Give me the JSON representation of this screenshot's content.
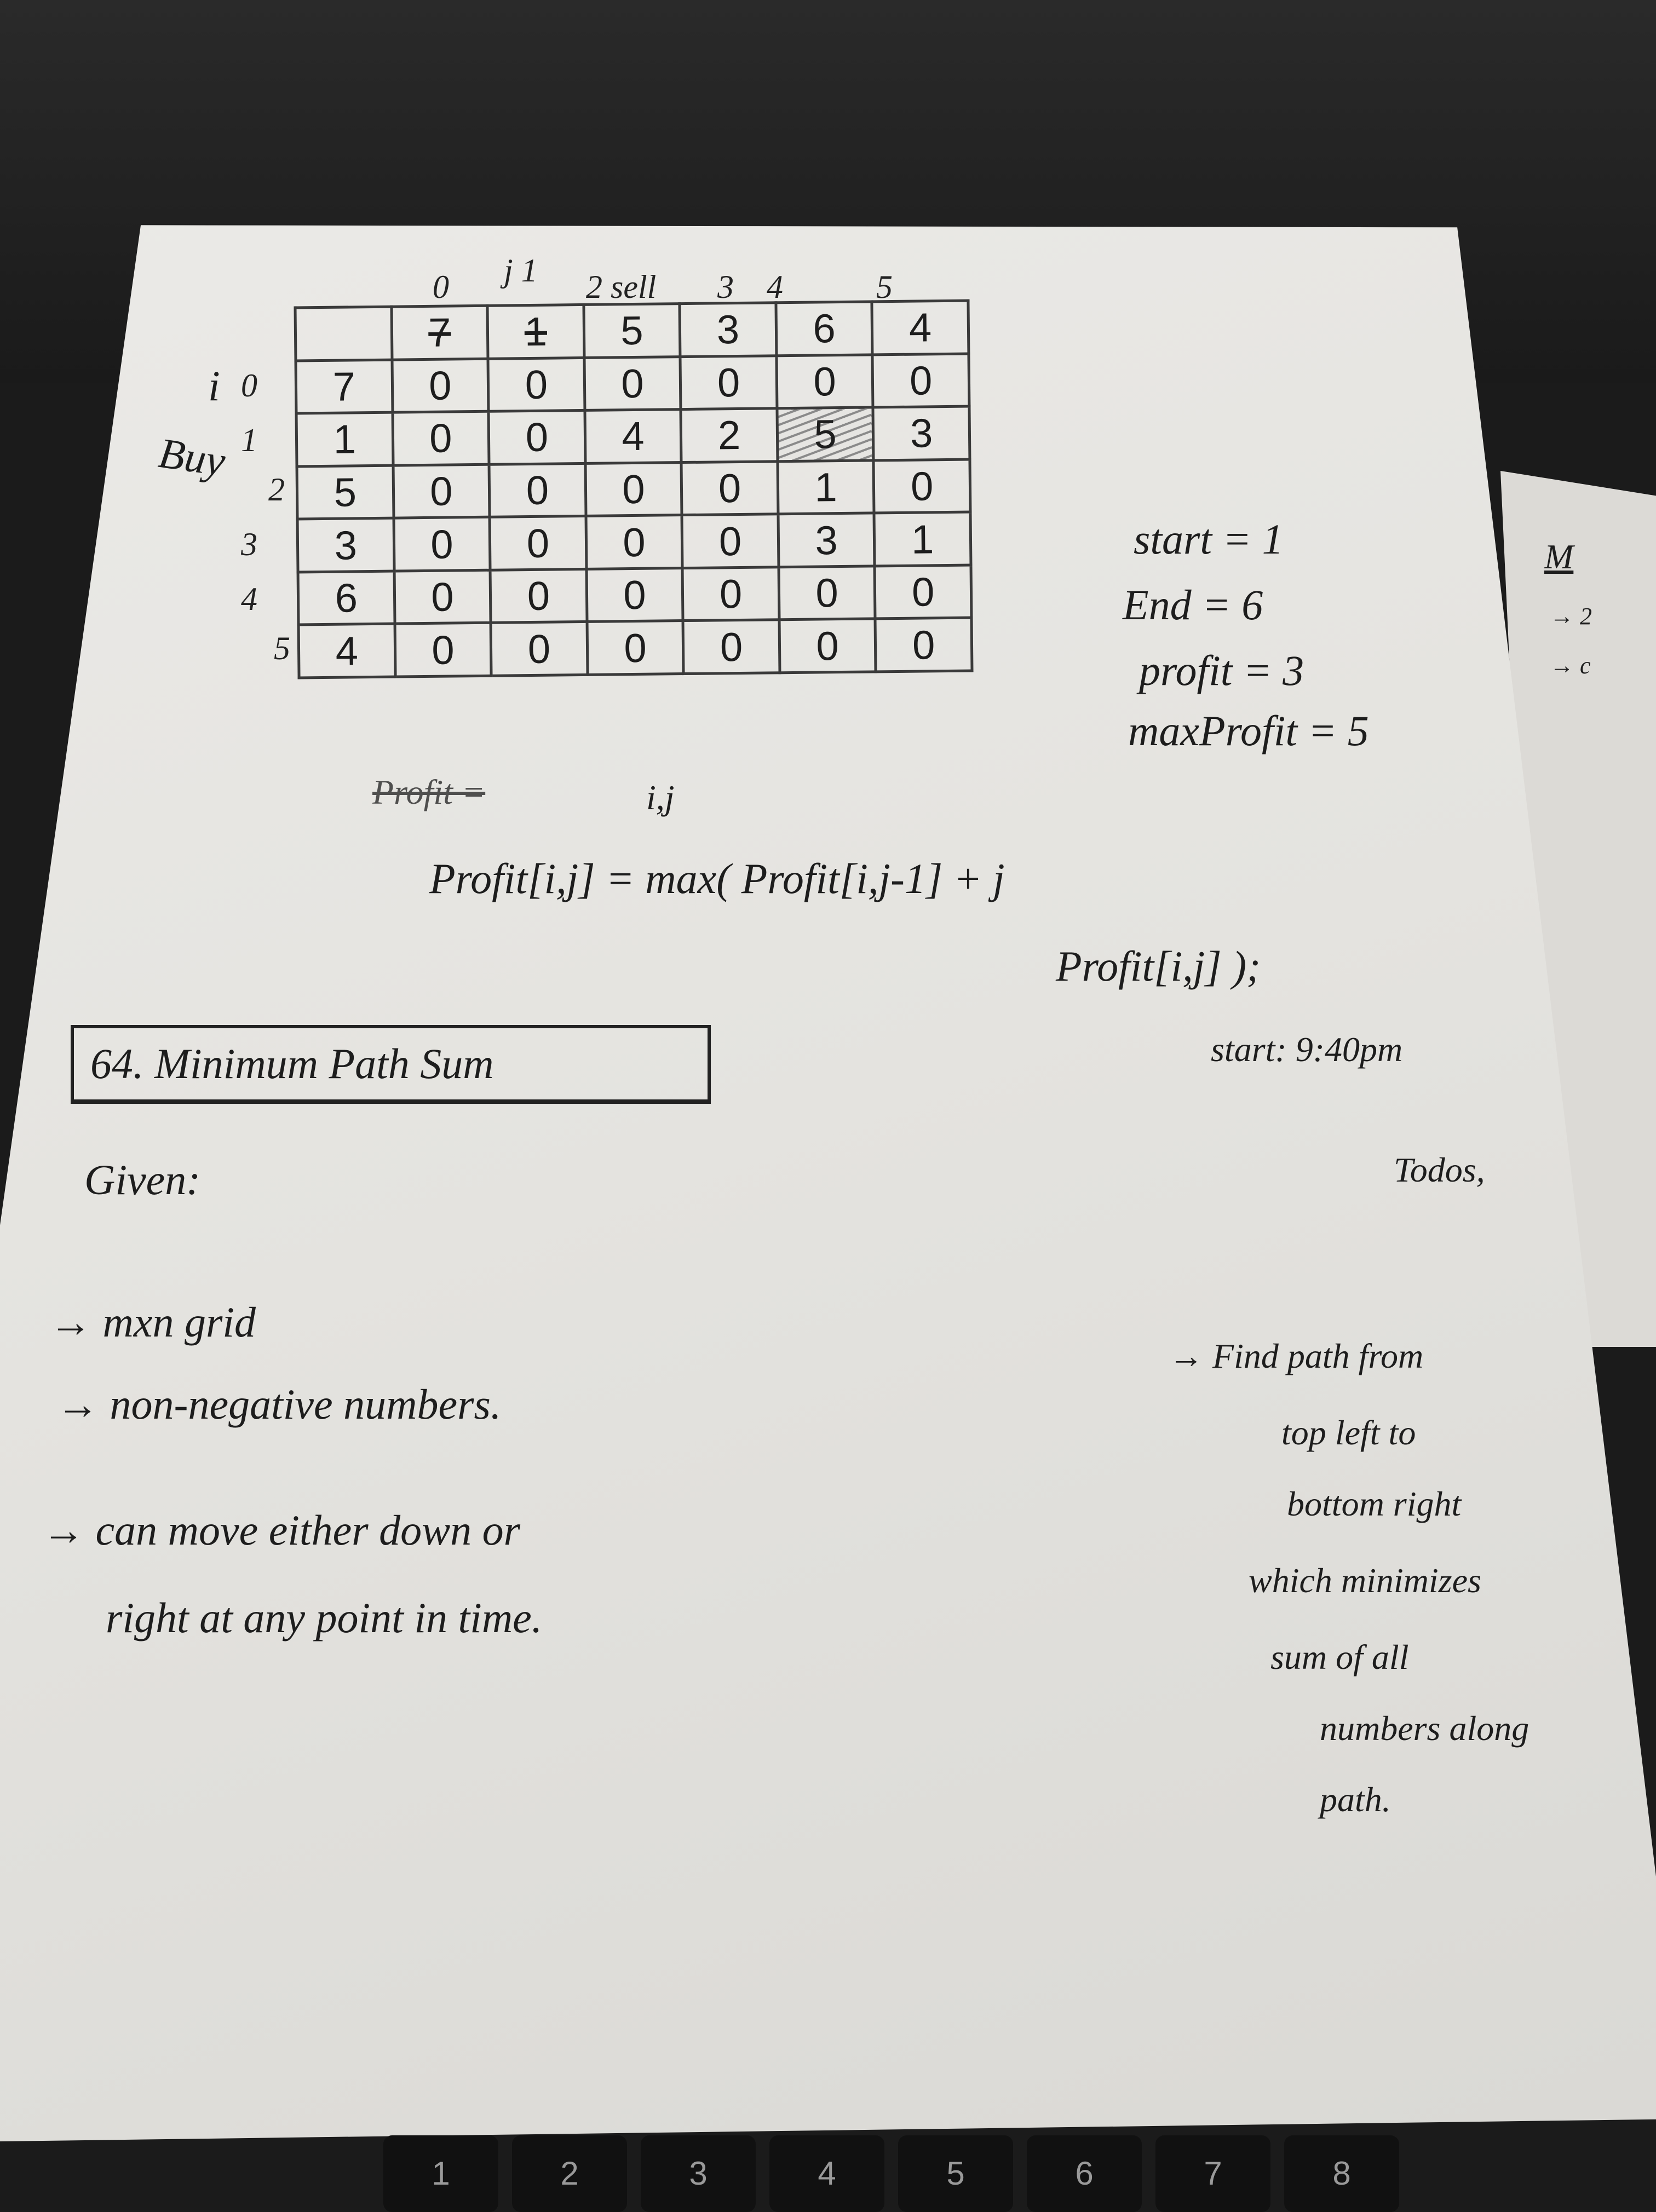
{
  "table": {
    "column_indices": [
      "0",
      "j 1",
      "2 sell",
      "3",
      "4",
      "5"
    ],
    "row_axis_labels": {
      "i": "i",
      "buy": "Buy"
    },
    "row_indices": [
      "0",
      "1",
      "2",
      "3",
      "4",
      "5"
    ],
    "prices": [
      "7",
      "1",
      "5",
      "3",
      "6",
      "4"
    ],
    "rows": [
      [
        "0",
        "0",
        "0",
        "0",
        "0",
        "0"
      ],
      [
        "0",
        "0",
        "4",
        "2",
        "5",
        "3"
      ],
      [
        "0",
        "0",
        "0",
        "0",
        "1",
        "0"
      ],
      [
        "0",
        "0",
        "0",
        "0",
        "3",
        "1"
      ],
      [
        "0",
        "0",
        "0",
        "0",
        "0",
        "0"
      ],
      [
        "0",
        "0",
        "0",
        "0",
        "0",
        "0"
      ]
    ]
  },
  "vars": {
    "start": "start = 1",
    "end": "End = 6",
    "profit": "profit = 3",
    "max_profit": "maxProfit = 5"
  },
  "formula": {
    "struck": "Profit =",
    "ij": "i,j",
    "line1": "Profit[i,j] = max( Profit[i,j-1] + j",
    "line2": "Profit[i,j] );"
  },
  "start_time": "start: 9:40pm",
  "problem_title": "64. Minimum Path Sum",
  "given_label": "Given:",
  "todos_label": "Todos,",
  "given_items": [
    "→ mxn grid",
    "→ non-negative numbers.",
    "→ can move either down or",
    "right at any point in time."
  ],
  "todo_lines": [
    "→ Find path from",
    "top left to",
    "bottom right",
    "which minimizes",
    "sum of all",
    "numbers along",
    "path."
  ],
  "side_page": {
    "heading": "M",
    "arrow1": "→ 2",
    "arrow2": "→ c"
  },
  "keyboard_keys": [
    "1",
    "2",
    "3",
    "4",
    "5",
    "6",
    "7",
    "8"
  ]
}
